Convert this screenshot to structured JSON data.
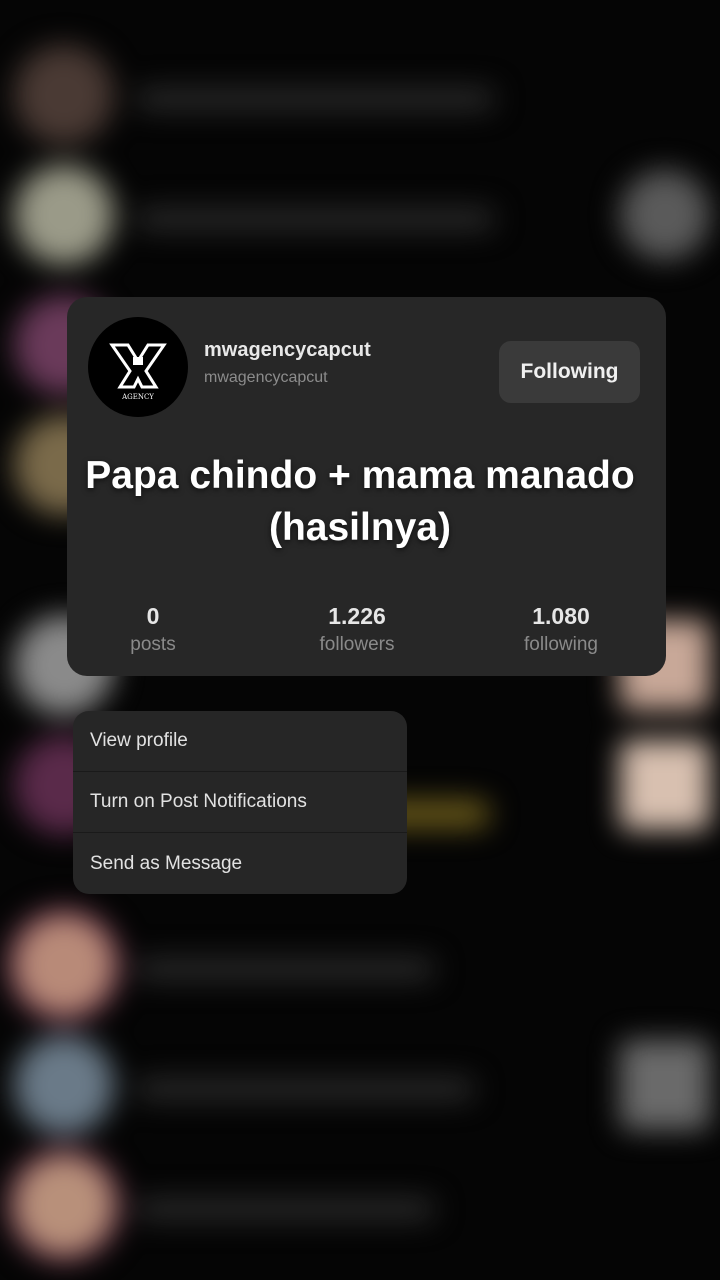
{
  "profile": {
    "avatar_logo_text": "AGENCY",
    "username": "mwagencycapcut",
    "handle": "mwagencycapcut",
    "follow_label": "Following",
    "stats": [
      {
        "value": "0",
        "label": "posts"
      },
      {
        "value": "1.226",
        "label": "followers"
      },
      {
        "value": "1.080",
        "label": "following"
      }
    ]
  },
  "caption": {
    "line1": "Papa chindo + mama manado",
    "line2": "(hasilnya)"
  },
  "menu": {
    "items": [
      "View profile",
      "Turn on Post Notifications",
      "Send as Message"
    ]
  },
  "colors": {
    "card_bg": "#272727",
    "button_bg": "#3a3a3a",
    "page_bg": "#050505"
  }
}
